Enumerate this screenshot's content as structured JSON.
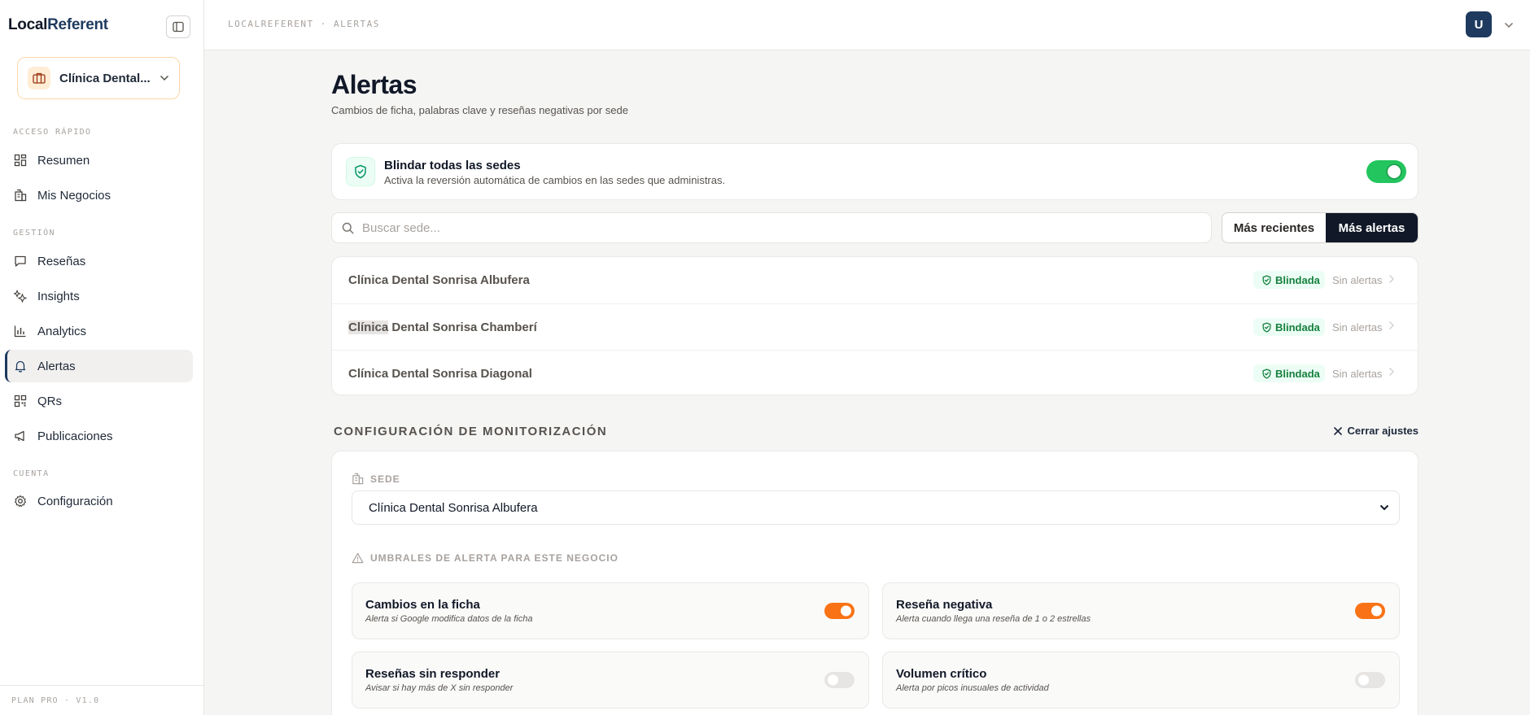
{
  "brand": {
    "local": "Local",
    "referent": "Referent"
  },
  "business_selector": {
    "name": "Clínica Dental..."
  },
  "nav": {
    "sections": {
      "quick": "ACCESO RÁPIDO",
      "manage": "GESTIÓN",
      "account": "CUENTA"
    },
    "items": [
      {
        "label": "Resumen",
        "icon": "dashboard-icon"
      },
      {
        "label": "Mis Negocios",
        "icon": "building-icon"
      },
      {
        "label": "Reseñas",
        "icon": "message-icon"
      },
      {
        "label": "Insights",
        "icon": "sparkles-icon"
      },
      {
        "label": "Analytics",
        "icon": "bar-chart-icon"
      },
      {
        "label": "Alertas",
        "icon": "bell-icon",
        "active": true
      },
      {
        "label": "QRs",
        "icon": "qr-code-icon"
      },
      {
        "label": "Publicaciones",
        "icon": "megaphone-icon"
      },
      {
        "label": "Configuración",
        "icon": "gear-icon"
      }
    ],
    "plan": "PLAN PRO · V1.0"
  },
  "header": {
    "breadcrumb": "LOCALREFERENT · ALERTAS",
    "avatar_initial": "U"
  },
  "page": {
    "title": "Alertas",
    "subtitle": "Cambios de ficha, palabras clave y reseñas negativas por sede"
  },
  "shield_all": {
    "title": "Blindar todas las sedes",
    "description": "Activa la reversión automática de cambios en las sedes que administras.",
    "enabled": true
  },
  "search": {
    "placeholder": "Buscar sede..."
  },
  "sort": {
    "recent": "Más recientes",
    "most": "Más alertas",
    "active": "most"
  },
  "locations": [
    {
      "name": "Clínica Dental Sonrisa Albufera",
      "badge": "Blindada",
      "status": "Sin alertas"
    },
    {
      "name_highlight": "Clínica",
      "name_rest": " Dental Sonrisa Chamberí",
      "badge": "Blindada",
      "status": "Sin alertas"
    },
    {
      "name": "Clínica Dental Sonrisa Diagonal",
      "badge": "Blindada",
      "status": "Sin alertas"
    }
  ],
  "config": {
    "title": "CONFIGURACIÓN DE MONITORIZACIÓN",
    "close_label": "Cerrar ajustes",
    "sede_label": "SEDE",
    "sede_value": "Clínica Dental Sonrisa Albufera",
    "thresholds_label": "UMBRALES DE ALERTA PARA ESTE NEGOCIO",
    "alerts": [
      {
        "title": "Cambios en la ficha",
        "description": "Alerta si Google modifica datos de la ficha",
        "enabled": true
      },
      {
        "title": "Reseña negativa",
        "description": "Alerta cuando llega una reseña de 1 o 2 estrellas",
        "enabled": true
      },
      {
        "title": "Reseñas sin responder",
        "description": "Avisar si hay más de X sin responder",
        "enabled": false
      },
      {
        "title": "Volumen crítico",
        "description": "Alerta por picos inusuales de actividad",
        "enabled": false
      }
    ]
  },
  "colors": {
    "accent_navy": "#1e3a5f",
    "toggle_green": "#22c55e",
    "toggle_orange": "#f97316",
    "toggle_off": "#e7e5e4",
    "badge_green": "#15803d"
  }
}
